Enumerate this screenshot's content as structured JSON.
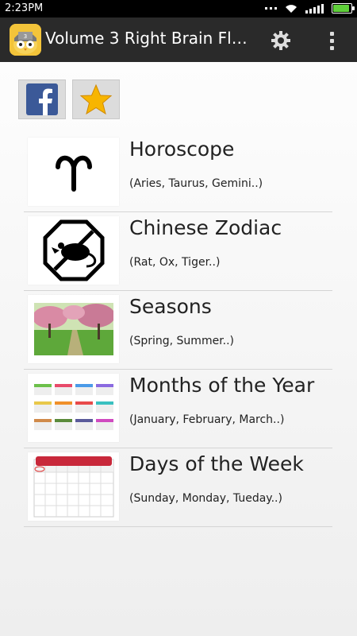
{
  "status_bar": {
    "time": "2:23PM",
    "icons": [
      "dots-icon",
      "wifi-icon",
      "signal-icon",
      "battery-icon"
    ],
    "battery_color": "#5fcf3a"
  },
  "action_bar": {
    "title": "Volume 3 Right Brain Flas...",
    "app_icon": "owl-head-icon",
    "settings_icon": "gear-icon",
    "overflow_icon": "overflow-menu-icon",
    "background": "#2a2a2a"
  },
  "share": {
    "facebook_icon": "facebook-icon",
    "favorite_icon": "star-icon"
  },
  "categories": [
    {
      "title": "Horoscope",
      "subtitle": "(Aries, Taurus, Gemini..)",
      "thumb": "aries-symbol"
    },
    {
      "title": "Chinese Zodiac",
      "subtitle": "(Rat, Ox, Tiger..)",
      "thumb": "rat-octagon"
    },
    {
      "title": "Seasons",
      "subtitle": "(Spring, Summer..)",
      "thumb": "spring-park-photo"
    },
    {
      "title": "Months of the Year",
      "subtitle": "(January, February, March..)",
      "thumb": "month-calendars"
    },
    {
      "title": "Days of the Week",
      "subtitle": "(Sunday, Monday, Tueday..)",
      "thumb": "week-calendar"
    }
  ]
}
